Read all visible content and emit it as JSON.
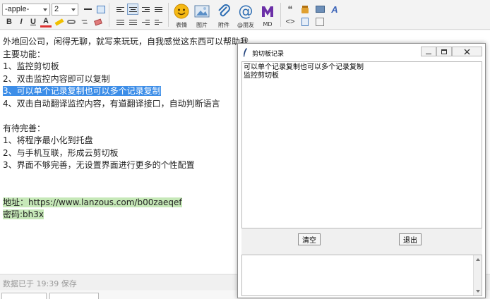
{
  "toolbar": {
    "font_family": "-apple-",
    "font_size": "2",
    "format_buttons": [
      "B",
      "I",
      "U",
      "A"
    ],
    "quote_label": "“",
    "code_label": "<>",
    "big_buttons": [
      {
        "icon": "emoji-icon",
        "label": "表情"
      },
      {
        "icon": "image-icon",
        "label": "图片"
      },
      {
        "icon": "attachment-icon",
        "label": "附件"
      },
      {
        "icon": "at-icon",
        "label": "@朋友"
      },
      {
        "icon": "markdown-icon",
        "label": "MD"
      }
    ],
    "colors": {
      "accent": "#3d8ee8",
      "emoji": "#f5b914",
      "md": "#6b2fa7",
      "at": "#2d6db3"
    }
  },
  "editor": {
    "lines": [
      "外地回公司，闲得无聊，就写来玩玩，自我感觉这东西可以帮助我",
      "主要功能：",
      "1、监控剪切板",
      "2、双击监控内容即可以复制",
      "3、可以单个记录复制也可以多个记录复制",
      "4、双击自动翻译监控内容，有道翻译接口，自动判断语言",
      "",
      "有待完善：",
      "1、将程序最小化到托盘",
      "2、与手机互联，形成云剪切板",
      "3、界面不够完善，无设置界面进行更多的个性配置",
      "",
      ""
    ],
    "address_label": "地址：",
    "address_url": "https://www.lanzous.com/b00zaeqef",
    "password": "密码:bh3x"
  },
  "status": "数据已于 19:39 保存",
  "window": {
    "title": "剪切板记录",
    "records": "可以单个记录复制也可以多个记录复制\n监控剪切板",
    "clear_button": "清空",
    "exit_button": "退出"
  }
}
